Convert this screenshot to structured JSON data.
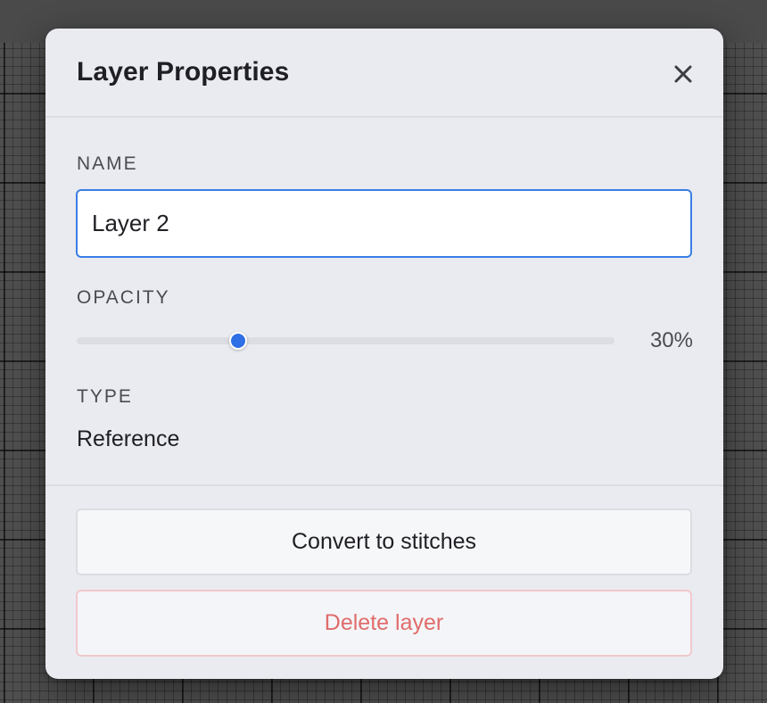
{
  "modal": {
    "title": "Layer Properties",
    "close_icon": "close-icon"
  },
  "name_field": {
    "label": "NAME",
    "value": "Layer 2"
  },
  "opacity": {
    "label": "OPACITY",
    "value_text": "30%",
    "value_fraction": 0.3
  },
  "type": {
    "label": "TYPE",
    "value": "Reference"
  },
  "actions": {
    "convert_label": "Convert to stitches",
    "delete_label": "Delete layer"
  },
  "colors": {
    "accent": "#2f6fe6",
    "danger": "#e06c6c",
    "modal_background": "#eaebf0"
  }
}
